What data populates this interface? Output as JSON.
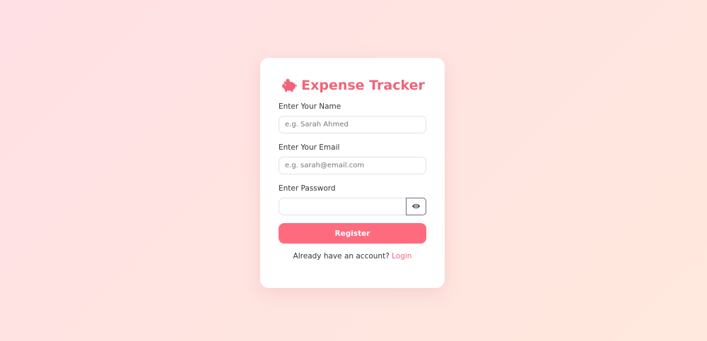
{
  "brand": {
    "icon": "piggy-bank-icon",
    "title": "Expense Tracker",
    "accent_color": "#f06478"
  },
  "form": {
    "name": {
      "label": "Enter Your Name",
      "placeholder": "e.g. Sarah Ahmed",
      "value": ""
    },
    "email": {
      "label": "Enter Your Email",
      "placeholder": "e.g. sarah@email.com",
      "value": ""
    },
    "password": {
      "label": "Enter Password",
      "placeholder": "",
      "value": "",
      "toggle_icon": "eye-icon"
    },
    "submit_label": "Register",
    "submit_color": "#ff6b7e"
  },
  "footer": {
    "prompt": "Already have an account?",
    "link_label": "Login"
  }
}
